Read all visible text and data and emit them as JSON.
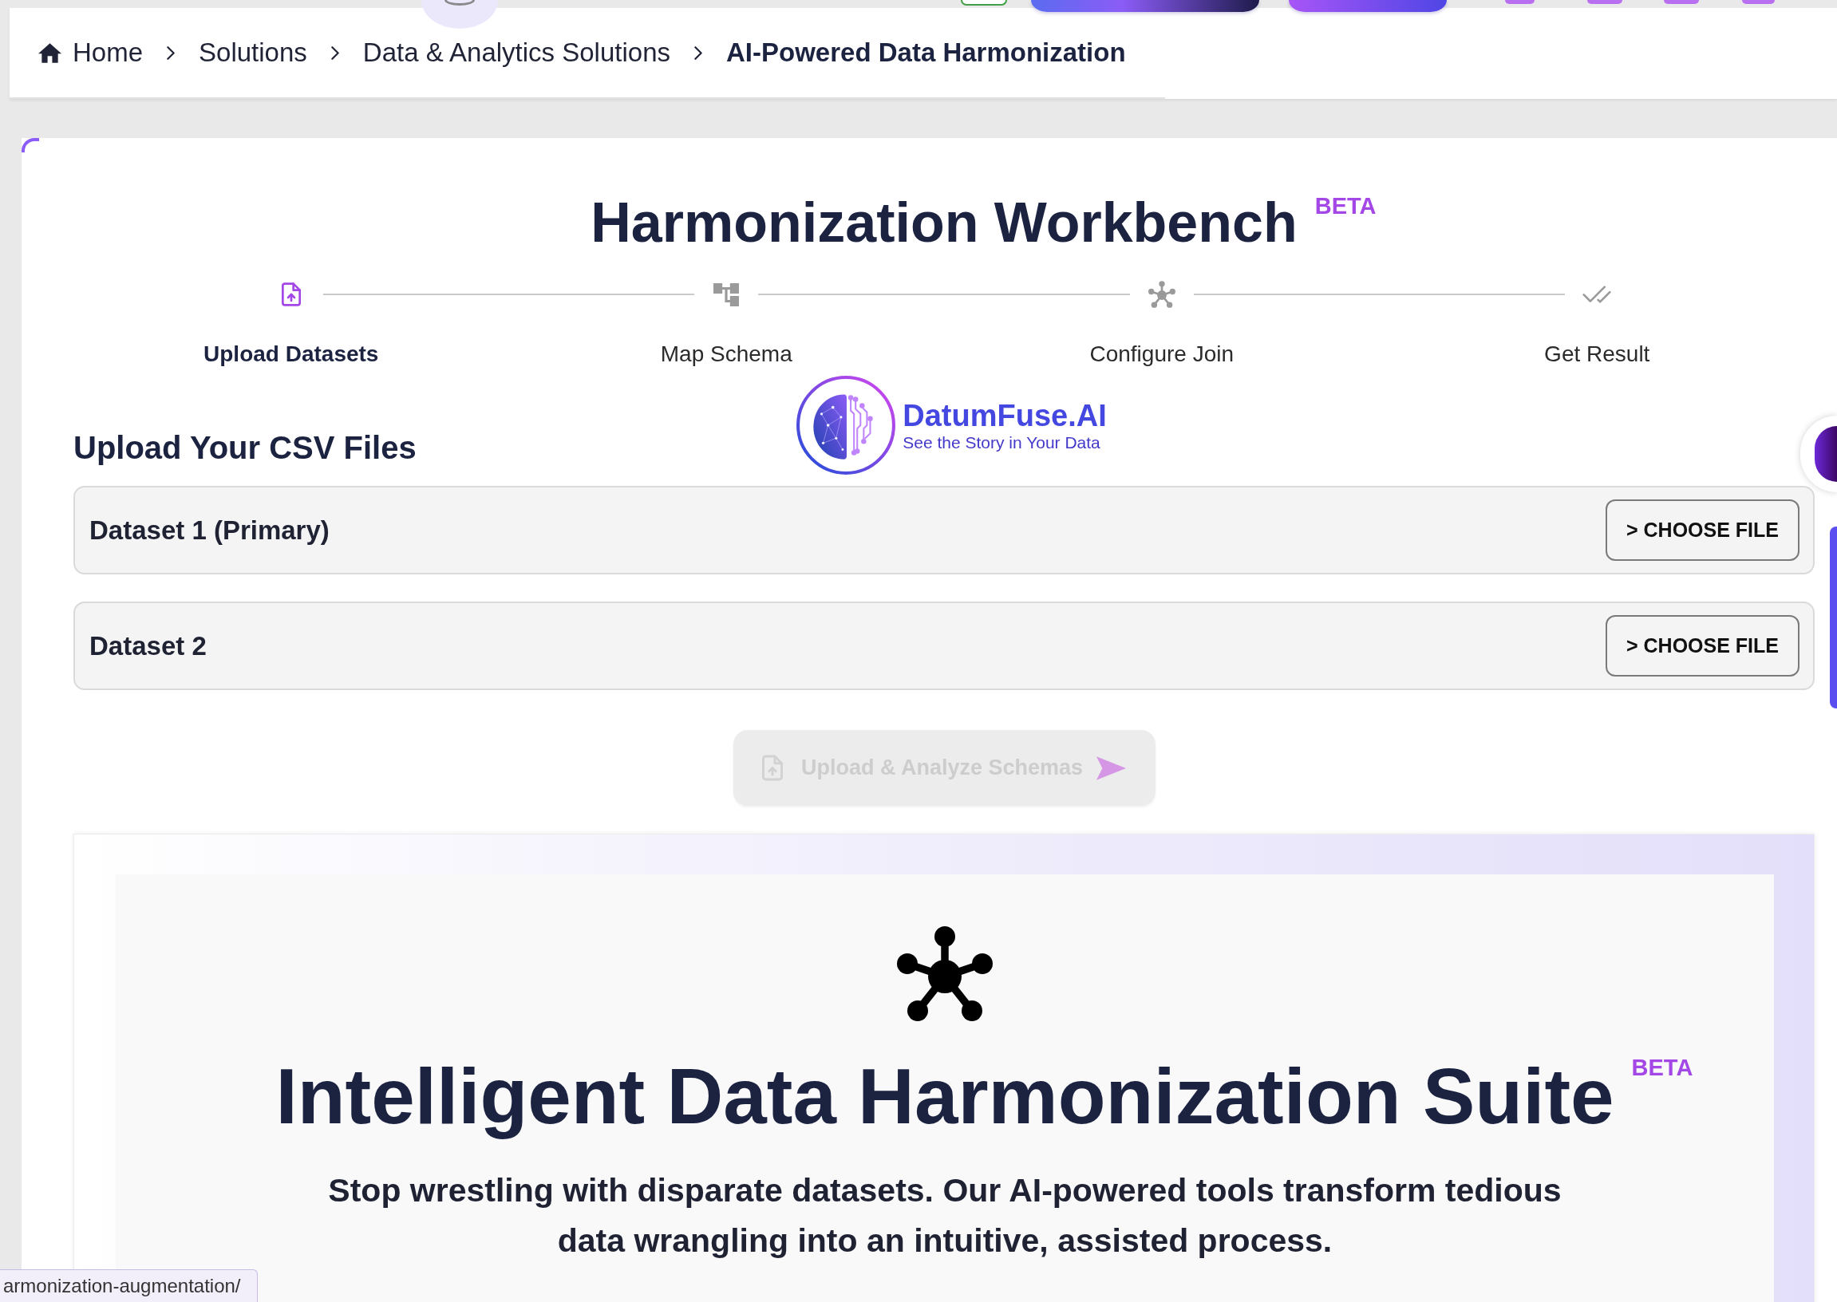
{
  "breadcrumb": [
    {
      "label": "Home",
      "kind": "home",
      "current": false
    },
    {
      "label": "Solutions",
      "kind": "link",
      "current": false
    },
    {
      "label": "Data & Analytics Solutions",
      "kind": "link",
      "current": false
    },
    {
      "label": "AI-Powered Data Harmonization",
      "kind": "link",
      "current": true
    }
  ],
  "workbench": {
    "title": "Harmonization Workbench",
    "badge": "BETA"
  },
  "steps": [
    {
      "label": "Upload Datasets",
      "kind": "upload",
      "selected": true
    },
    {
      "label": "Map Schema",
      "kind": "map",
      "selected": false
    },
    {
      "label": "Configure Join",
      "kind": "join",
      "selected": false
    },
    {
      "label": "Get Result",
      "kind": "result",
      "selected": false
    }
  ],
  "logo": {
    "name": "DatumFuse.AI",
    "tagline": "See the Story in Your Data"
  },
  "upload_section": {
    "heading": "Upload Your CSV Files",
    "datasets": [
      {
        "label": "Dataset 1 (Primary)",
        "button": "> CHOOSE FILE"
      },
      {
        "label": "Dataset 2",
        "button": "> CHOOSE FILE"
      }
    ],
    "submit": {
      "label": "Upload & Analyze Schemas",
      "disabled": true
    }
  },
  "hero": {
    "title": "Intelligent Data Harmonization Suite",
    "badge": "BETA",
    "subtitle": "Stop wrestling with disparate datasets. Our AI-powered tools transform tedious data wrangling into an intuitive, assisted process."
  },
  "status_bar": {
    "url": "armonization-augmentation/"
  }
}
